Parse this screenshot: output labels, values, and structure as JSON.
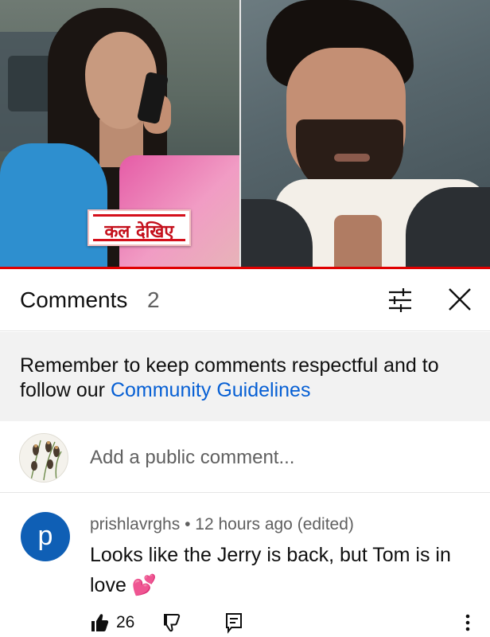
{
  "video": {
    "caption": "कल देखिए",
    "accent_color": "#e00000"
  },
  "comments_header": {
    "title": "Comments",
    "count": "2",
    "filter_icon": "sliders-icon",
    "close_icon": "close-icon"
  },
  "guidelines": {
    "text": "Remember to keep comments respectful and to follow our ",
    "link_text": "Community Guidelines",
    "link_color": "#065fd4"
  },
  "add_comment": {
    "placeholder": "Add a public comment..."
  },
  "comments": [
    {
      "avatar_letter": "p",
      "avatar_color": "#0f5fb5",
      "author": "prishlavrghs",
      "separator": "•",
      "time": "12 hours ago (edited)",
      "text": "Looks like the Jerry is back, but Tom is in love 💕",
      "likes": "26",
      "like_icon": "thumbs-up-icon",
      "dislike_icon": "thumbs-down-icon",
      "reply_icon": "reply-icon"
    }
  ],
  "more_icon": "more-vertical-icon"
}
